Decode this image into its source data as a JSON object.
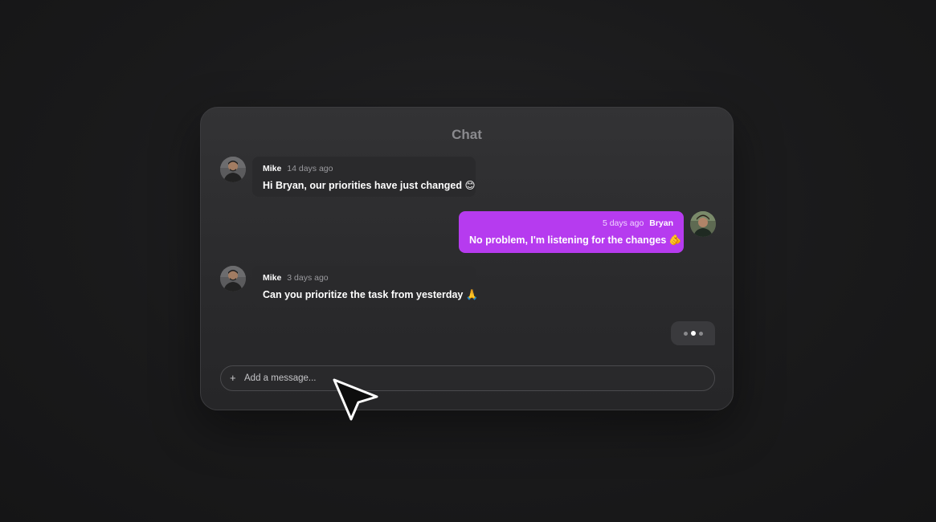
{
  "chat": {
    "title": "Chat",
    "messages": [
      {
        "sender": "Mike",
        "time": "14 days ago",
        "text": "Hi Bryan, our priorities have just changed 😊",
        "direction": "incoming"
      },
      {
        "sender": "Bryan",
        "time": "5 days ago",
        "text": "No problem, I'm listening for the changes 🫵",
        "direction": "outgoing"
      },
      {
        "sender": "Mike",
        "time": "3 days ago",
        "text": "Can you prioritize the task from yesterday 🙏",
        "direction": "incoming"
      }
    ],
    "typing_indicator": {
      "dots": 3,
      "active_dot": 2
    }
  },
  "composer": {
    "add_icon": "+",
    "placeholder": "Add a message..."
  },
  "icons": {
    "add": "plus-icon",
    "cursor": "mouse-pointer-icon"
  },
  "colors": {
    "background": "#1a1a1b",
    "panel": "#2f2f31",
    "incoming_bubble": "#2a2a2c",
    "outgoing_bubble": "#b63bef",
    "title": "#8a8a8e"
  }
}
